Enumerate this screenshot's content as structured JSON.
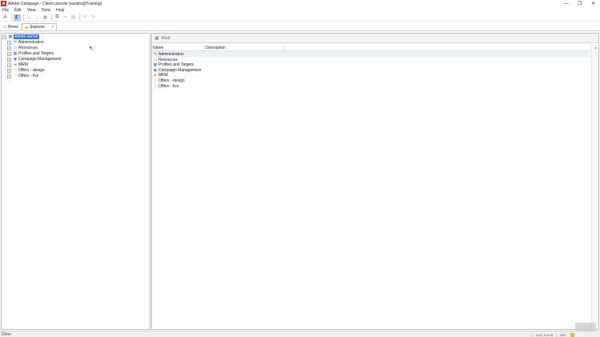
{
  "window": {
    "logo": "A",
    "title": "Adobe Campaign - Client console (sandra@Training)",
    "controls": {
      "minimize": "—",
      "maximize": "❐",
      "close": "✕"
    }
  },
  "menu": [
    "File",
    "Edit",
    "View",
    "Tools",
    "Help"
  ],
  "tabs": {
    "home_label": "Home",
    "explorer_label": "Explorer",
    "close_glyph": "×"
  },
  "tree": {
    "root": {
      "label": "Adobe server",
      "expander": "−"
    },
    "children": [
      {
        "label": "Administration",
        "expander": "+",
        "icon": "wrench-icon"
      },
      {
        "label": "Resources",
        "expander": "+",
        "icon": "window-icon"
      },
      {
        "label": "Profiles and Targets",
        "expander": "+",
        "icon": "profiles-icon"
      },
      {
        "label": "Campaign Management",
        "expander": "+",
        "icon": "campaign-icon"
      },
      {
        "label": "MRM",
        "expander": "+",
        "icon": "folder-icon"
      },
      {
        "label": "Offers - design",
        "expander": "+",
        "icon": "offer-icon"
      },
      {
        "label": "Offers - live",
        "expander": "+",
        "icon": "offer-icon"
      }
    ]
  },
  "list": {
    "root_label": "Root",
    "columns": {
      "name": "Name",
      "description": "Description"
    },
    "rows": [
      {
        "label": "Administration",
        "icon": "wrench-icon"
      },
      {
        "label": "Resources",
        "icon": "window-icon"
      },
      {
        "label": "Profiles and Targets",
        "icon": "profiles-icon"
      },
      {
        "label": "Campaign Management",
        "icon": "campaign-icon"
      },
      {
        "label": "MRM",
        "icon": "folder-icon"
      },
      {
        "label": "Offers - design",
        "icon": "offer-icon"
      },
      {
        "label": "Offers - live",
        "icon": "offer-icon"
      }
    ]
  },
  "status": {
    "text": "Done",
    "position": "Ln 8, Col 15",
    "mode": "INS"
  },
  "colors": {
    "selection": "#2f78c8",
    "accent": "#2f6db5",
    "brand": "#e1251b"
  }
}
